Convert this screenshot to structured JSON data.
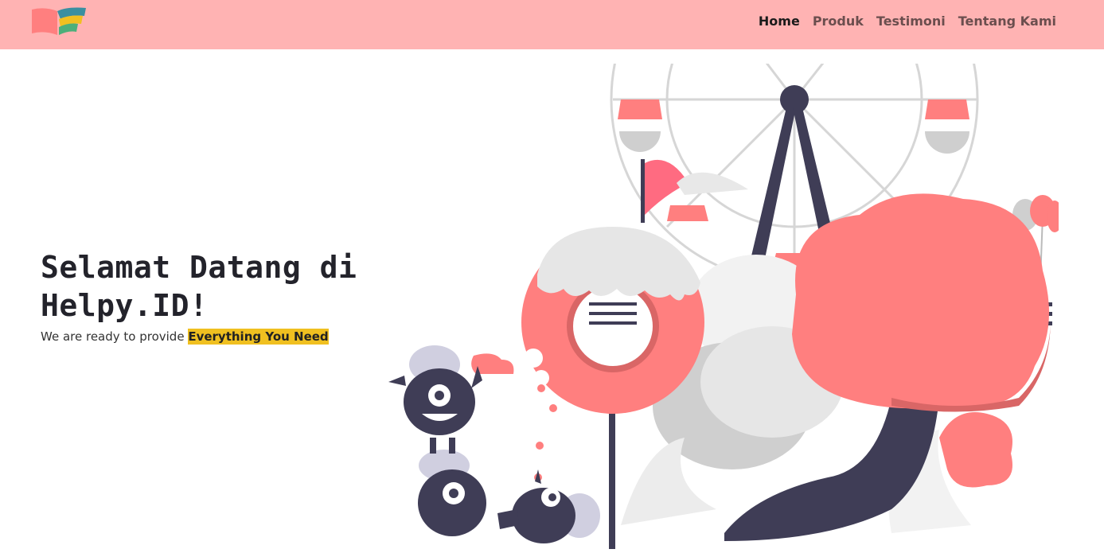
{
  "nav": {
    "logo": "helpy-logo",
    "items": [
      {
        "label": "Home",
        "active": true
      },
      {
        "label": "Produk",
        "active": false
      },
      {
        "label": "Testimoni",
        "active": false
      },
      {
        "label": "Tentang Kami",
        "active": false
      }
    ]
  },
  "hero": {
    "title_line1": "Selamat Datang di",
    "title_line2": "Helpy.ID!",
    "subtitle_prefix": "We are ready to provide ",
    "subtitle_highlight": "Everything You Need",
    "illustration": "amusement-park-illustration"
  },
  "colors": {
    "navbar": "#ffb3b3",
    "accent": "#f0c020",
    "coral": "#ff7f7f",
    "dark": "#3f3d56"
  }
}
